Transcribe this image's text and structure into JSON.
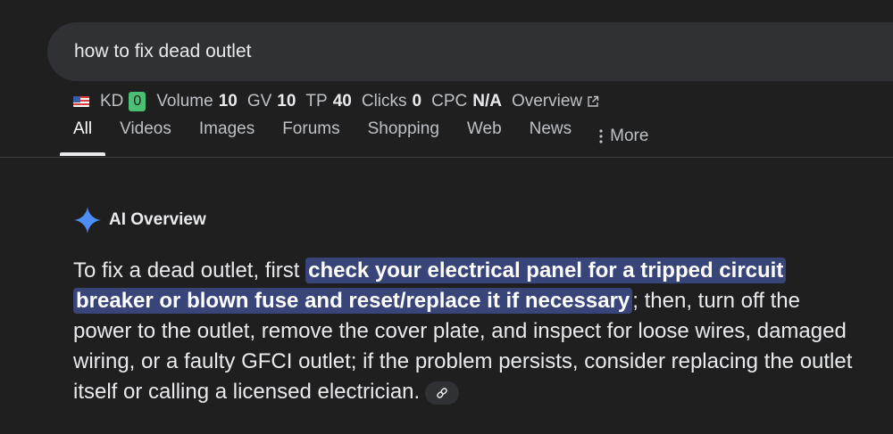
{
  "search": {
    "query": "how to fix dead outlet"
  },
  "metrics": {
    "kd_label": "KD",
    "kd_value": "0",
    "volume_label": "Volume",
    "volume_value": "10",
    "gv_label": "GV",
    "gv_value": "10",
    "tp_label": "TP",
    "tp_value": "40",
    "clicks_label": "Clicks",
    "clicks_value": "0",
    "cpc_label": "CPC",
    "cpc_value": "N/A",
    "overview_label": "Overview",
    "flag_icon": "us-flag-icon",
    "kd_badge_color": "#4bbf73"
  },
  "tabs": [
    {
      "label": "All",
      "active": true
    },
    {
      "label": "Videos"
    },
    {
      "label": "Images"
    },
    {
      "label": "Forums"
    },
    {
      "label": "Shopping"
    },
    {
      "label": "Web"
    },
    {
      "label": "News"
    },
    {
      "label": "More",
      "icon": "more-vert-icon"
    }
  ],
  "ai_overview": {
    "title": "AI Overview",
    "icon": "sparkle-icon",
    "text_before": "To fix a dead outlet, first ",
    "highlight": "check your electrical panel for a tripped circuit breaker or blown fuse and reset/replace it if necessary",
    "text_after": "; then, turn off the power to the outlet, remove the cover plate, and inspect for loose wires, damaged wiring, or a faulty GFCI outlet; if the problem persists, consider replacing the outlet itself or calling a licensed electrician.",
    "link_icon": "link-icon",
    "highlight_color": "#394579",
    "sparkle_color": "#4c8df6"
  }
}
